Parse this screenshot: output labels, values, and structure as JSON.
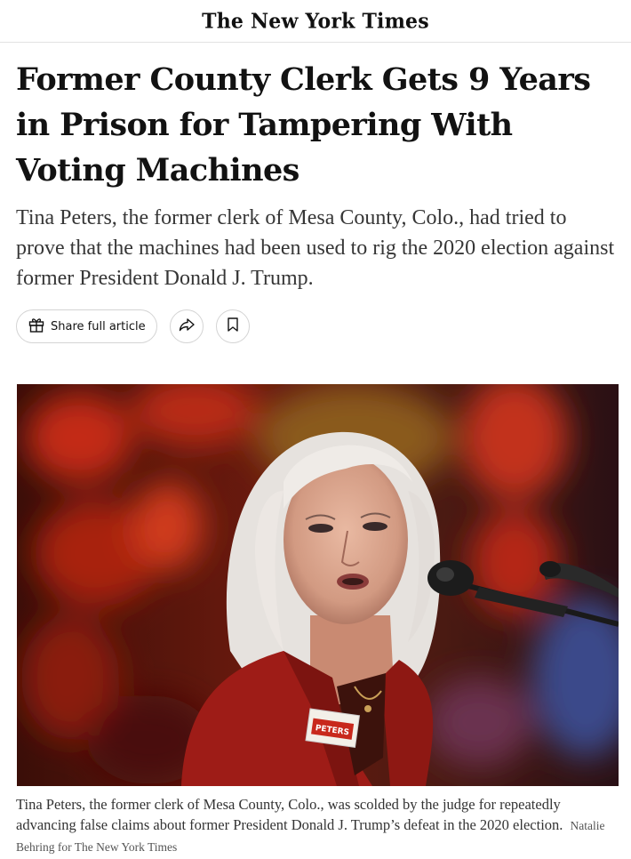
{
  "masthead": {
    "logo_text": "The New York Times"
  },
  "article": {
    "headline": "Former County Clerk Gets 9 Years in Prison for Tampering With Voting Machines",
    "summary": "Tina Peters, the former clerk of Mesa County, Colo., had tried to prove that the machines had been used to rig the 2020 election against former President Donald J. Trump."
  },
  "share_bar": {
    "share_label": "Share full article",
    "icons": [
      "gift-icon",
      "share-arrow-icon",
      "bookmark-icon"
    ]
  },
  "photo": {
    "badge_text": "PETERS",
    "caption": "Tina Peters, the former clerk of Mesa County, Colo., was scolded by the judge for repeatedly advancing false claims about former President Donald J. Trump’s defeat in the 2020 election.",
    "credit": "Natalie Behring for The New York Times"
  },
  "colors": {
    "text": "#121212",
    "summary": "#363636",
    "border": "#d4d4d4",
    "jacket": "#9e1c17"
  }
}
